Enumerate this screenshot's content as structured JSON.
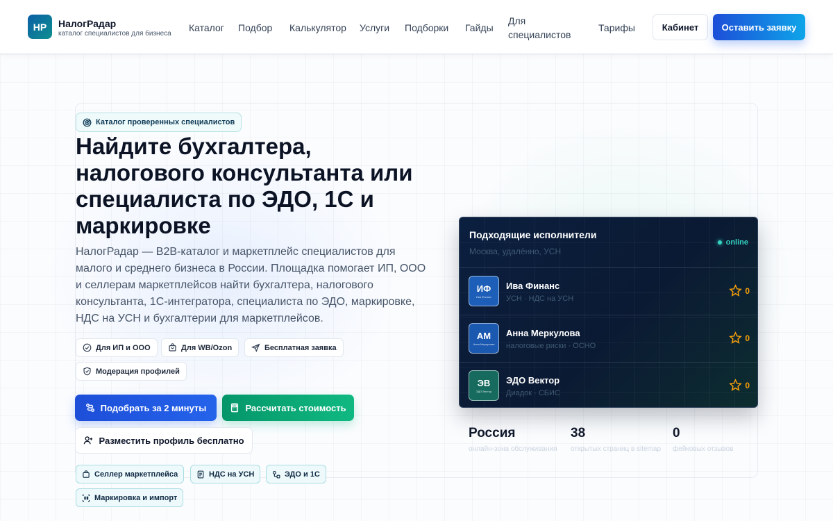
{
  "header": {
    "logo_initials": "НР",
    "brand_name": "НалогРадар",
    "brand_tagline": "каталог специалистов для бизнеса",
    "nav": [
      "Каталог",
      "Подбор",
      "Калькулятор",
      "Услуги",
      "Подборки",
      "Гайды",
      "Для специалистов",
      "Тарифы"
    ],
    "cabinet_label": "Кабинет",
    "apply_label": "Оставить заявку"
  },
  "hero": {
    "badge": "Каталог проверенных специалистов",
    "title": "Найдите бухгалтера, налогового консультанта или специалиста по ЭДО, 1С и маркировке",
    "description": "НалогРадар — B2B-каталог и маркетплейс специалистов для малого и среднего бизнеса в России. Площадка помогает ИП, ООО и селлерам маркетплейсов найти бухгалтера, налогового консультанта, 1С-интегратора, специалиста по ЭДО, маркировке, НДС на УСН и бухгалтерии для маркетплейсов.",
    "features": [
      "Для ИП и ООО",
      "Для WB/Ozon",
      "Бесплатная заявка",
      "Модерация профилей"
    ],
    "cta_primary": "Подобрать за 2 минуты",
    "cta_secondary": "Рассчитать стоимость",
    "cta_tertiary": "Разместить профиль бесплатно",
    "tags": [
      "Селлер маркетплейса",
      "НДС на УСН",
      "ЭДО и 1С",
      "Маркировка и импорт"
    ]
  },
  "card": {
    "title": "Подходящие исполнители",
    "subtitle": "Москва, удалённо, УСН",
    "status": "online",
    "items": [
      {
        "initials": "ИФ",
        "logo_text": "Ива Финанс",
        "name": "Ива Финанс",
        "meta": "УСН · НДС на УСН",
        "rating": "0",
        "color": "#1d5fb8"
      },
      {
        "initials": "АМ",
        "logo_text": "Анна Меркулова",
        "name": "Анна Меркулова",
        "meta": "налоговые риски · ОСНО",
        "rating": "0",
        "color": "#1b58b0"
      },
      {
        "initials": "ЭВ",
        "logo_text": "ЭДО Вектор",
        "name": "ЭДО Вектор",
        "meta": "Диадок · СБИС",
        "rating": "0",
        "color": "#166b5e"
      }
    ]
  },
  "stats": [
    {
      "value": "Россия",
      "label": "онлайн-зона обслуживания"
    },
    {
      "value": "38",
      "label": "открытых страниц в sitemap"
    },
    {
      "value": "0",
      "label": "фейковых отзывов"
    }
  ]
}
